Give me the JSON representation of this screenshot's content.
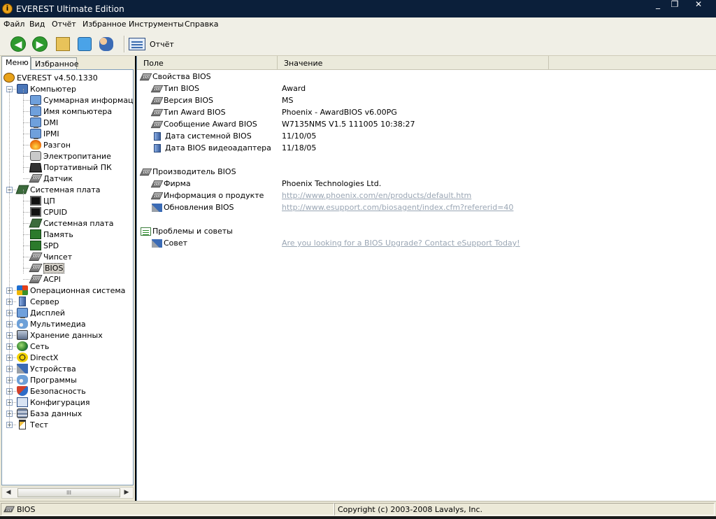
{
  "window": {
    "title": "EVEREST Ultimate Edition",
    "buttons": [
      "_",
      "❐",
      "✕"
    ]
  },
  "menu": [
    "Файл",
    "Вид",
    "Отчёт",
    "Избранное",
    "Инструменты",
    "Справка"
  ],
  "toolbar": {
    "report_label": "Отчёт",
    "icons": [
      "back-icon",
      "forward-icon",
      "up-folder-icon",
      "refresh-icon",
      "users-icon",
      "report-icon"
    ]
  },
  "left_tabs": [
    "Меню",
    "Избранное"
  ],
  "tree": {
    "root": "EVEREST v4.50.1330",
    "nodes": [
      {
        "label": "Компьютер",
        "level": 1,
        "icon": "computer-icon",
        "expanded": true
      },
      {
        "label": "Суммарная информация",
        "level": 2,
        "icon": "monitor-icon"
      },
      {
        "label": "Имя компьютера",
        "level": 2,
        "icon": "monitor-icon"
      },
      {
        "label": "DMI",
        "level": 2,
        "icon": "monitor-icon"
      },
      {
        "label": "IPMI",
        "level": 2,
        "icon": "monitor-icon"
      },
      {
        "label": "Разгон",
        "level": 2,
        "icon": "flame-icon"
      },
      {
        "label": "Электропитание",
        "level": 2,
        "icon": "plug-icon"
      },
      {
        "label": "Портативный ПК",
        "level": 2,
        "icon": "laptop-icon"
      },
      {
        "label": "Датчик",
        "level": 2,
        "icon": "chip-icon"
      },
      {
        "label": "Системная плата",
        "level": 1,
        "icon": "motherboard-icon",
        "expanded": true
      },
      {
        "label": "ЦП",
        "level": 2,
        "icon": "cpu-icon"
      },
      {
        "label": "CPUID",
        "level": 2,
        "icon": "cpu-icon"
      },
      {
        "label": "Системная плата",
        "level": 2,
        "icon": "motherboard-icon"
      },
      {
        "label": "Память",
        "level": 2,
        "icon": "ram-icon"
      },
      {
        "label": "SPD",
        "level": 2,
        "icon": "ram-icon"
      },
      {
        "label": "Чипсет",
        "level": 2,
        "icon": "chip-icon"
      },
      {
        "label": "BIOS",
        "level": 2,
        "icon": "chip-icon",
        "selected": true
      },
      {
        "label": "ACPI",
        "level": 2,
        "icon": "chip-icon"
      },
      {
        "label": "Операционная система",
        "level": 1,
        "icon": "windows-flag-icon"
      },
      {
        "label": "Сервер",
        "level": 1,
        "icon": "server-icon"
      },
      {
        "label": "Дисплей",
        "level": 1,
        "icon": "display-icon"
      },
      {
        "label": "Мультимедиа",
        "level": 1,
        "icon": "speaker-icon"
      },
      {
        "label": "Хранение данных",
        "level": 1,
        "icon": "disk-icon"
      },
      {
        "label": "Сеть",
        "level": 1,
        "icon": "globe-icon"
      },
      {
        "label": "DirectX",
        "level": 1,
        "icon": "directx-icon"
      },
      {
        "label": "Устройства",
        "level": 1,
        "icon": "devices-icon"
      },
      {
        "label": "Программы",
        "level": 1,
        "icon": "programs-icon"
      },
      {
        "label": "Безопасность",
        "level": 1,
        "icon": "shield-icon"
      },
      {
        "label": "Конфигурация",
        "level": 1,
        "icon": "config-icon"
      },
      {
        "label": "База данных",
        "level": 1,
        "icon": "database-icon"
      },
      {
        "label": "Тест",
        "level": 1,
        "icon": "hourglass-icon"
      }
    ]
  },
  "table": {
    "columns": [
      "Поле",
      "Значение"
    ],
    "groups": [
      {
        "title": "Свойства BIOS",
        "icon": "chip-icon",
        "rows": [
          {
            "field": "Тип BIOS",
            "value": "Award",
            "icon": "chip-icon"
          },
          {
            "field": "Версия BIOS",
            "value": "MS",
            "icon": "chip-icon"
          },
          {
            "field": "Тип Award BIOS",
            "value": "Phoenix - AwardBIOS v6.00PG",
            "icon": "chip-icon"
          },
          {
            "field": "Сообщение Award BIOS",
            "value": "W7135NMS V1.5 111005 10:38:27",
            "icon": "chip-icon"
          },
          {
            "field": "Дата системной BIOS",
            "value": "11/10/05",
            "icon": "date-icon"
          },
          {
            "field": "Дата BIOS видеоадаптера",
            "value": "11/18/05",
            "icon": "date-icon"
          }
        ]
      },
      {
        "title": "Производитель BIOS",
        "icon": "chip-icon",
        "rows": [
          {
            "field": "Фирма",
            "value": "Phoenix Technologies Ltd.",
            "icon": "chip-icon"
          },
          {
            "field": "Информация о продукте",
            "value": "http://www.phoenix.com/en/products/default.htm",
            "icon": "chip-icon",
            "link": true
          },
          {
            "field": "Обновления BIOS",
            "value": "http://www.esupport.com/biosagent/index.cfm?refererid=40",
            "icon": "tool-icon",
            "link": true
          }
        ]
      },
      {
        "title": "Проблемы и советы",
        "icon": "tips-icon",
        "rows": [
          {
            "field": "Совет",
            "value": "Are you looking for a BIOS Upgrade?  Contact eSupport Today!",
            "icon": "tool-icon",
            "link": true
          }
        ]
      }
    ]
  },
  "status": {
    "left": "BIOS",
    "right": "Copyright (c) 2003-2008 Lavalys, Inc."
  },
  "scrollbar_grip": "III"
}
